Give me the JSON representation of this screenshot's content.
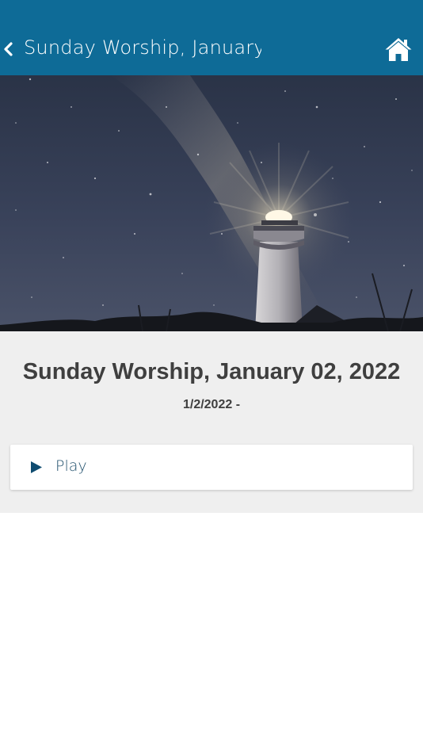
{
  "header": {
    "title": "Sunday Worship, January…",
    "background": "#0e6b97",
    "back_icon": "chevron-left-icon",
    "home_icon": "home-icon"
  },
  "hero": {
    "subject": "lighthouse under starry night sky"
  },
  "event": {
    "title": "Sunday Worship, January 02, 2022",
    "date": "1/2/2022 -"
  },
  "media": {
    "play_label": "Play",
    "play_icon": "play-icon",
    "accent": "#0f4c70"
  }
}
